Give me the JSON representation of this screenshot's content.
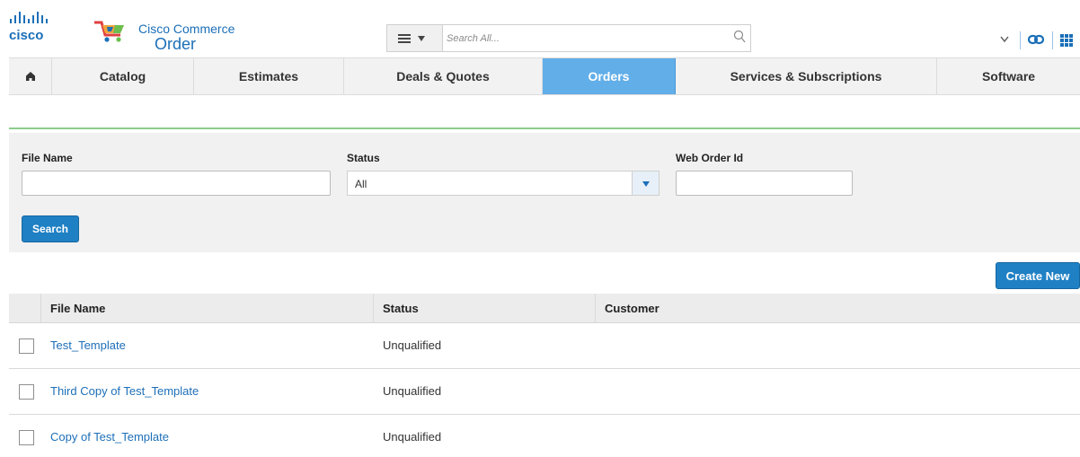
{
  "header": {
    "brand_logo_text": "cisco",
    "app_name_top": "Cisco Commerce",
    "app_name_bottom": "Order",
    "search_placeholder": "Search All...",
    "accent_color": "#1b6fb8"
  },
  "nav": {
    "tabs": [
      {
        "label": "",
        "icon": "home-icon"
      },
      {
        "label": "Catalog"
      },
      {
        "label": "Estimates"
      },
      {
        "label": "Deals & Quotes"
      },
      {
        "label": "Orders",
        "active": true
      },
      {
        "label": "Services & Subscriptions"
      },
      {
        "label": "Software"
      }
    ],
    "active_color": "#62aee8"
  },
  "filters": {
    "file_name_label": "File Name",
    "file_name_value": "",
    "status_label": "Status",
    "status_value": "All",
    "web_order_id_label": "Web Order Id",
    "web_order_id_value": "",
    "search_button": "Search"
  },
  "actions": {
    "create_new": "Create New"
  },
  "table": {
    "columns": [
      "File Name",
      "Status",
      "Customer"
    ],
    "rows": [
      {
        "file_name": "Test_Template",
        "status": "Unqualified",
        "customer": ""
      },
      {
        "file_name": "Third Copy of Test_Template",
        "status": "Unqualified",
        "customer": ""
      },
      {
        "file_name": "Copy of Test_Template",
        "status": "Unqualified",
        "customer": ""
      }
    ]
  }
}
